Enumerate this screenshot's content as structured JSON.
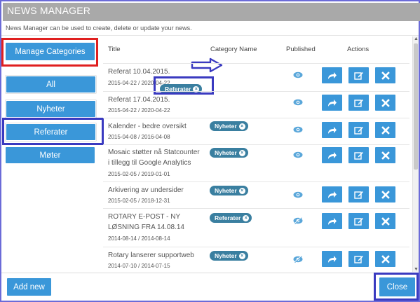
{
  "window": {
    "title": "NEWS MANAGER"
  },
  "description": "News Manager can be used to create, delete or update your news.",
  "manage_categories_label": "Manage Categories",
  "categories": [
    "All",
    "Nyheter",
    "Referater",
    "Møter"
  ],
  "columns": {
    "title": "Title",
    "category": "Category Name",
    "published": "Published",
    "actions": "Actions"
  },
  "rows": [
    {
      "title_lines": [
        "Referat 10.04.2015."
      ],
      "dates": "2015-04-22 / 2020-04-22",
      "category": "Referater"
    },
    {
      "title_lines": [
        "Referat 17.04.2015."
      ],
      "dates": "2015-04-22 / 2020-04-22",
      "category": ""
    },
    {
      "title_lines": [
        "Kalender - bedre oversikt"
      ],
      "dates": "2015-04-08 / 2016-04-08",
      "category": "Nyheter"
    },
    {
      "title_lines": [
        "Mosaic støtter nå Statcounter",
        "i tillegg til Google Analytics"
      ],
      "dates": "2015-02-05 / 2019-01-01",
      "category": "Nyheter"
    },
    {
      "title_lines": [
        "Arkivering av undersider"
      ],
      "dates": "2015-02-05 / 2018-12-31",
      "category": "Nyheter"
    },
    {
      "title_lines": [
        "ROTARY E-POST - NY",
        "LØSNING FRA 14.08.14"
      ],
      "dates": "2014-08-14 / 2014-08-14",
      "category": "Referater"
    },
    {
      "title_lines": [
        "Rotary lanserer supportweb"
      ],
      "dates": "2014-07-10 / 2014-07-15",
      "category": "Nyheter"
    }
  ],
  "add_new_label": "Add new",
  "close_label": "Close",
  "colors": {
    "primary": "#3a97d9",
    "badge": "#3a7fa0",
    "annotation_red": "#e02020",
    "annotation_blue": "#3a3ac0",
    "titlebar": "#a9a9a9"
  },
  "icons": {
    "share": "share-arrow-icon",
    "edit": "edit-pencil-icon",
    "delete": "close-x-icon",
    "published": "eye-icon"
  }
}
